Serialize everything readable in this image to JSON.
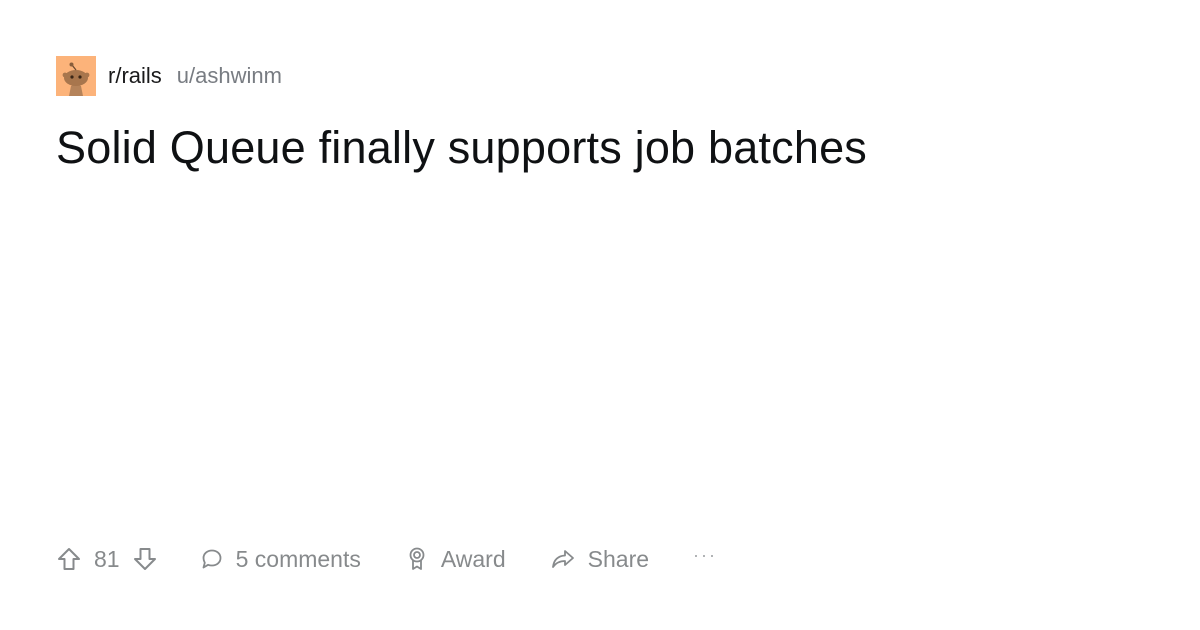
{
  "post": {
    "subreddit": "r/rails",
    "author": "u/ashwinm",
    "title": "Solid Queue finally supports job batches",
    "avatar_icon": "subreddit-avatar-icon",
    "avatar_bg": "#fcb37a"
  },
  "actions": {
    "vote_count": "81",
    "comments_label": "5 comments",
    "award_label": "Award",
    "share_label": "Share",
    "more_label": "···"
  },
  "icons": {
    "upvote": "upvote-arrow-icon",
    "downvote": "downvote-arrow-icon",
    "comment": "comment-bubble-icon",
    "award": "award-medal-icon",
    "share": "share-arrow-icon"
  },
  "colors": {
    "text_primary": "#0f1113",
    "text_muted": "#878a8c",
    "author": "#787c82",
    "background": "#ffffff"
  }
}
